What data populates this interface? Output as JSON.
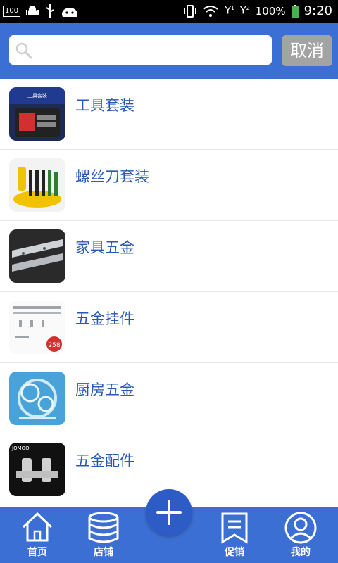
{
  "status_bar": {
    "battery_box": "100",
    "battery": "100%",
    "time": "9:20",
    "signal1": "Y",
    "signal1_sup": "1",
    "signal2": "Y",
    "signal2_sup": "2"
  },
  "header": {
    "search_placeholder": "",
    "cancel_label": "取消"
  },
  "categories": [
    {
      "name": "工具套装",
      "icon": "tool-kit-photo"
    },
    {
      "name": "螺丝刀套装",
      "icon": "screwdriver-set-photo"
    },
    {
      "name": "家具五金",
      "icon": "drawer-slide-photo"
    },
    {
      "name": "五金挂件",
      "icon": "towel-rack-photo",
      "badge": "258"
    },
    {
      "name": "厨房五金",
      "icon": "kitchen-rack-photo"
    },
    {
      "name": "五金配件",
      "icon": "faucet-valve-photo",
      "brand": "JOMOO"
    }
  ],
  "tabbar": {
    "home": "首页",
    "store": "店铺",
    "promo": "促销",
    "mine": "我的"
  },
  "colors": {
    "accent": "#3b6fd3",
    "label": "#2b58b6"
  }
}
